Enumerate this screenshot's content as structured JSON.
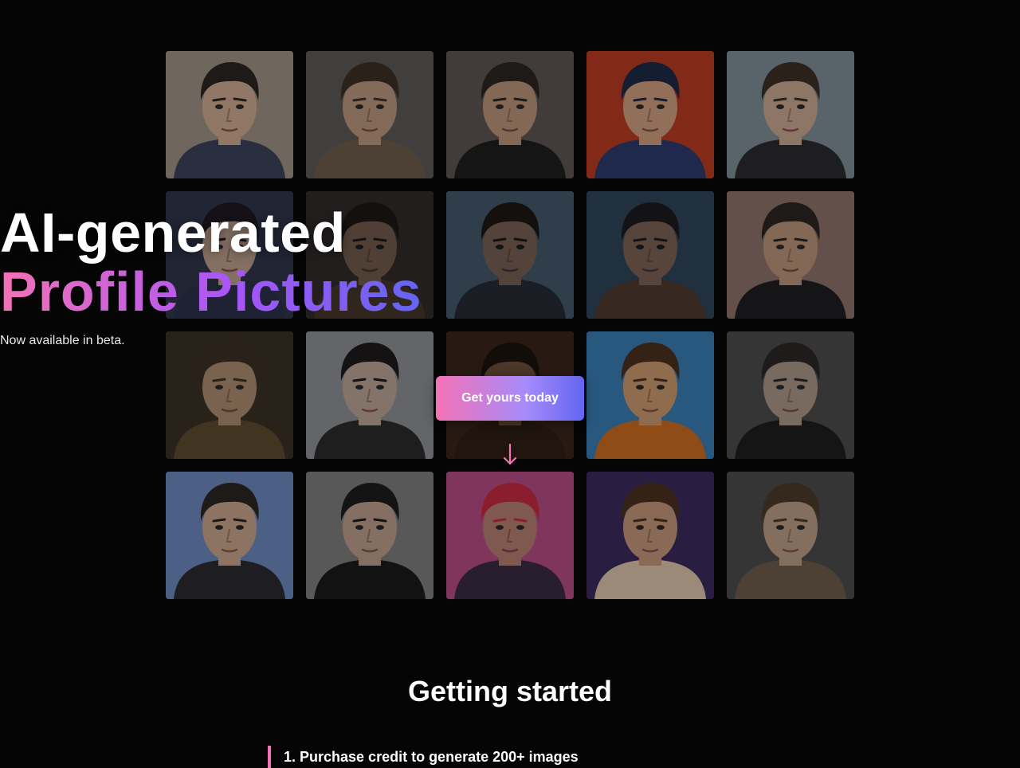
{
  "hero": {
    "headline_line1": "AI-generated",
    "headline_line2": "Profile Pictures",
    "subtitle": "Now available in beta.",
    "cta_label": "Get yours today",
    "scroll_icon": "arrow-down-icon"
  },
  "portraits": [
    {
      "bg": "#9a8f82",
      "hair": "#2a2420",
      "shirt": "#3a4258",
      "skin": "#c9a58c"
    },
    {
      "bg": "#5a5856",
      "hair": "#3a2e24",
      "shirt": "#6a5a48",
      "skin": "#b8957c"
    },
    {
      "bg": "#5a5250",
      "hair": "#2a2420",
      "shirt": "#1e1e1e",
      "skin": "#b89078"
    },
    {
      "bg": "#b53a22",
      "hair": "#1e2a44",
      "shirt": "#2a3a6a",
      "skin": "#c99a7c"
    },
    {
      "bg": "#7c8a94",
      "hair": "#3a2e24",
      "shirt": "#2a2a2e",
      "skin": "#c4a48e"
    },
    {
      "bg": "#2e3448",
      "hair": "#1c1a22",
      "shirt": "#2a3048",
      "skin": "#b89a88"
    },
    {
      "bg": "#4a4440",
      "hair": "#2a2420",
      "shirt": "#6a5440",
      "skin": "#b08c74"
    },
    {
      "bg": "#6a8aa8",
      "hair": "#2a2420",
      "shirt": "#3a4050",
      "skin": "#b89480"
    },
    {
      "bg": "#4a6a8a",
      "hair": "#2a2a30",
      "shirt": "#7a5a4a",
      "skin": "#c09a84"
    },
    {
      "bg": "#8a7068",
      "hair": "#2a2420",
      "shirt": "#1e1e22",
      "skin": "#b89078"
    },
    {
      "bg": "#3a3024",
      "hair": "#3a2e24",
      "shirt": "#5a4a30",
      "skin": "#a88a6c"
    },
    {
      "bg": "#8a8c90",
      "hair": "#1c1a1a",
      "shirt": "#2a2a2a",
      "skin": "#b8a090"
    },
    {
      "bg": "#5a3a2a",
      "hair": "#2a1e18",
      "shirt": "#4a3022",
      "skin": "#a87a5c"
    },
    {
      "bg": "#3a7ab0",
      "hair": "#4a3020",
      "shirt": "#c86a20",
      "skin": "#c8966c"
    },
    {
      "bg": "#4a4a4a",
      "hair": "#2a2624",
      "shirt": "#1e1e1e",
      "skin": "#a89484"
    },
    {
      "bg": "#6a84b8",
      "hair": "#2a2420",
      "shirt": "#2a2a30",
      "skin": "#c4a088"
    },
    {
      "bg": "#7a7a7a",
      "hair": "#1e1c1c",
      "shirt": "#1a1a1a",
      "skin": "#b89a88"
    },
    {
      "bg": "#b04a80",
      "hair": "#c02a40",
      "shirt": "#3a2a40",
      "skin": "#b07a70"
    },
    {
      "bg": "#3a2a5a",
      "hair": "#4a3020",
      "shirt": "#d8c0a8",
      "skin": "#c09478"
    },
    {
      "bg": "#4a4a4a",
      "hair": "#4a3a2a",
      "shirt": "#6a5a48",
      "skin": "#b89a84"
    }
  ],
  "getting_started": {
    "title": "Getting started",
    "step1": "1. Purchase credit to generate 200+ images"
  }
}
